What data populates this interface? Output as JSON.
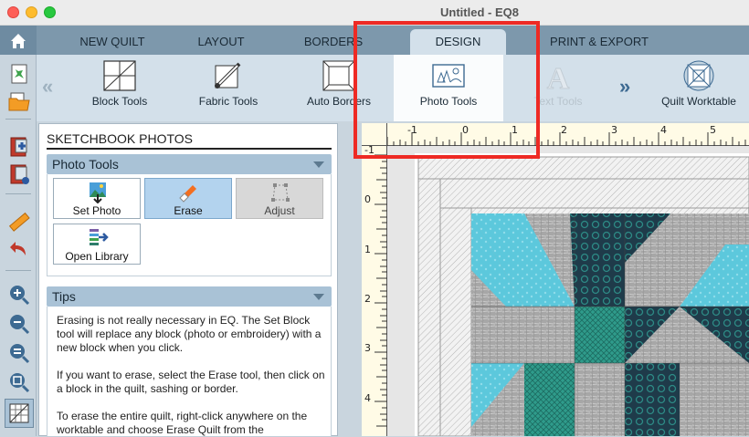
{
  "window": {
    "title": "Untitled - EQ8"
  },
  "tabs": [
    {
      "label": "NEW QUILT",
      "active": false
    },
    {
      "label": "LAYOUT",
      "active": false
    },
    {
      "label": "BORDERS",
      "active": false
    },
    {
      "label": "DESIGN",
      "active": true
    },
    {
      "label": "PRINT & EXPORT",
      "active": false
    }
  ],
  "ribbon": {
    "items": [
      {
        "label": "Block Tools",
        "icon": "block-tools-icon"
      },
      {
        "label": "Fabric Tools",
        "icon": "fabric-tools-icon"
      },
      {
        "label": "Auto Borders",
        "icon": "auto-borders-icon"
      },
      {
        "label": "Photo Tools",
        "icon": "photo-tools-icon",
        "active": true
      },
      {
        "label": "Text Tools",
        "icon": "text-tools-icon",
        "disabled": true
      }
    ],
    "worktable_label": "Quilt Worktable"
  },
  "left_toolbar": {
    "icons": [
      "home-icon",
      "new-quilt-icon",
      "open-folder-icon",
      "add-to-sketchbook-icon",
      "sketchbook-icon",
      "ruler-icon",
      "undo-icon",
      "zoom-in-icon",
      "zoom-out-icon",
      "fit-to-worktable-icon",
      "refresh-view-icon",
      "rulers-toggle-icon"
    ]
  },
  "panel": {
    "title": "SKETCHBOOK PHOTOS",
    "photo_tools": {
      "header": "Photo Tools",
      "buttons": [
        {
          "label": "Set Photo",
          "state": "normal"
        },
        {
          "label": "Erase",
          "state": "selected"
        },
        {
          "label": "Adjust",
          "state": "disabled"
        },
        {
          "label": "Open Library",
          "state": "normal"
        }
      ]
    },
    "tips": {
      "header": "Tips",
      "paragraphs": [
        "Erasing is not really necessary in EQ. The Set Block tool will replace any block (photo or embroidery) with a new block when you click.",
        "If you want to erase, select the Erase tool, then click on a block in the quilt, sashing or border.",
        "To erase the entire quilt, right-click anywhere on the worktable and choose Erase Quilt from the"
      ]
    }
  },
  "ruler": {
    "top_labels": [
      "-1",
      "0",
      "1",
      "2",
      "3",
      "4",
      "5"
    ],
    "left_labels": [
      "-1",
      "0",
      "1",
      "2",
      "3",
      "4"
    ]
  },
  "colors": {
    "accent_highlight": "#ee2a24",
    "tab_bar": "#7d98ac",
    "ribbon": "#d3e0ea",
    "selected_button": "#b3d3ee"
  }
}
